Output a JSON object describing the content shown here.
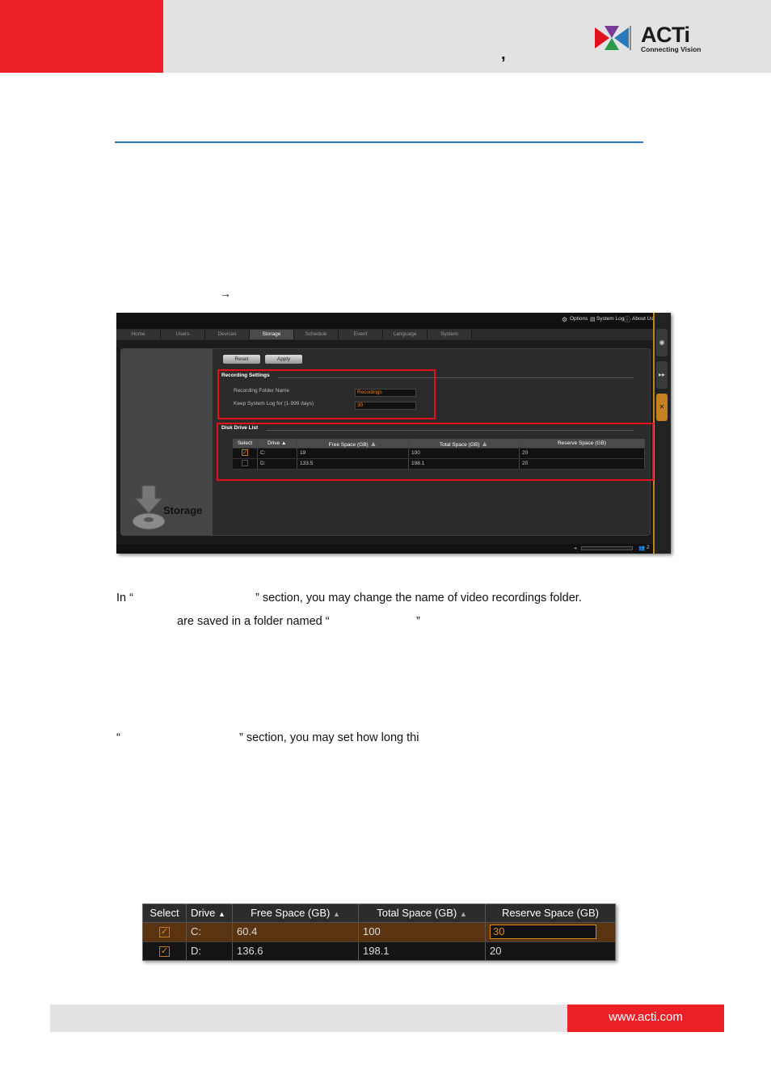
{
  "header": {
    "comma": ",",
    "logo_text": "ACTi",
    "logo_tagline": "Connecting Vision"
  },
  "arrow": "→",
  "screenshot_storage": {
    "top_menu": [
      "Options",
      "System Log",
      "About Us"
    ],
    "tabs": [
      "Home",
      "Users",
      "Devices",
      "Storage",
      "Schedule",
      "Event",
      "Language",
      "System"
    ],
    "active_tab": "Storage",
    "buttons": {
      "reset": "Reset",
      "apply": "Apply"
    },
    "recording_settings": {
      "title": "Recording Settings",
      "folder_label": "Recording Folder Name",
      "folder_value": "Recodings",
      "keep_log_label": "Keep System Log for (1-999 days)",
      "keep_log_value": "30"
    },
    "disk_drive_list": {
      "title": "Disk Drive List",
      "columns": [
        "Select",
        "Drive",
        "Free Space (GB)",
        "Total Space (GB)",
        "Reserve Space (GB)"
      ],
      "rows": [
        {
          "selected": true,
          "drive": "C:",
          "free": "19",
          "total": "100",
          "reserve": "20"
        },
        {
          "selected": false,
          "drive": "D:",
          "free": "133.5",
          "total": "198.1",
          "reserve": "20"
        }
      ]
    },
    "storage_label": "Storage",
    "user_count": "2"
  },
  "text": {
    "para1_line1_a": "In “",
    "para1_line1_b": "” section, you may change the name of video recordings folder.",
    "para1_line2_a": "are saved in a folder named “",
    "para1_line2_b": "”",
    "para2_a": "“",
    "para2_b": "” section, you may set how long thi"
  },
  "screenshot_drives": {
    "columns": [
      "Select",
      "Drive",
      "Free Space (GB)",
      "Total Space (GB)",
      "Reserve Space (GB)"
    ],
    "rows": [
      {
        "selected": true,
        "drive": "C:",
        "free": "60.4",
        "total": "100",
        "reserve": "30",
        "editing": true
      },
      {
        "selected": true,
        "drive": "D:",
        "free": "136.6",
        "total": "198.1",
        "reserve": "20",
        "editing": false
      }
    ],
    "sort_icons": [
      "▲",
      "▲",
      "▲"
    ]
  },
  "footer": {
    "url": "www.acti.com"
  }
}
